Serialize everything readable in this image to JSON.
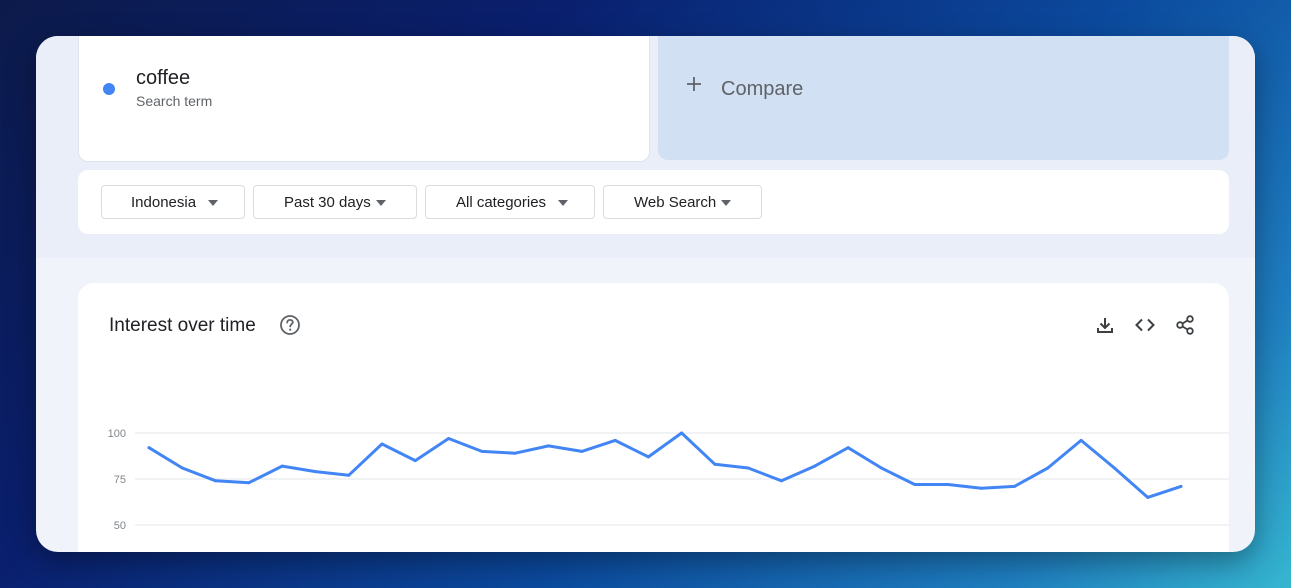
{
  "search": {
    "term": "coffee",
    "term_type": "Search term",
    "term_color": "#4285f4",
    "compare_label": "Compare",
    "compare_icon": "plus-icon"
  },
  "filters": [
    {
      "label": "Indonesia"
    },
    {
      "label": "Past 30 days"
    },
    {
      "label": "All categories"
    },
    {
      "label": "Web Search"
    }
  ],
  "chart": {
    "title": "Interest over time",
    "help_icon": "help-circle-icon",
    "tools": [
      "download-icon",
      "embed-code-icon",
      "share-icon"
    ]
  },
  "chart_data": {
    "type": "line",
    "title": "Interest over time",
    "xlabel": "",
    "ylabel": "",
    "y_ticks": [
      100,
      75,
      50
    ],
    "ylim_visible": [
      50,
      100
    ],
    "grid": true,
    "series": [
      {
        "color": "#4285f4",
        "values": [
          92,
          81,
          74,
          73,
          82,
          79,
          77,
          94,
          85,
          97,
          90,
          89,
          93,
          90,
          96,
          87,
          100,
          83,
          81,
          74,
          82,
          92,
          81,
          72,
          72,
          70,
          71,
          81,
          96,
          81,
          65,
          71
        ]
      }
    ]
  }
}
